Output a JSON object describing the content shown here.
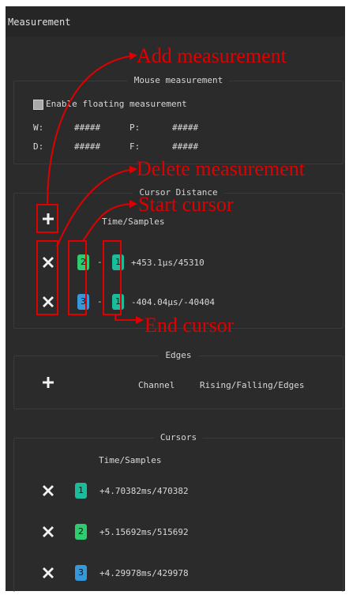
{
  "window": {
    "title": "Measurement"
  },
  "mouse_measurement": {
    "title": "Mouse measurement",
    "enable_label": "Enable floating measurement",
    "fields": [
      {
        "label": "W:",
        "value": "#####"
      },
      {
        "label": "P:",
        "value": "#####"
      },
      {
        "label": "D:",
        "value": "#####"
      },
      {
        "label": "F:",
        "value": "#####"
      }
    ]
  },
  "cursor_distance": {
    "title": "Cursor Distance",
    "header": "Time/Samples",
    "rows": [
      {
        "start": "2",
        "separator": "-",
        "end": "1",
        "value": "+453.1µs/45310"
      },
      {
        "start": "3",
        "separator": "-",
        "end": "1",
        "value": "-404.04µs/-40404"
      }
    ]
  },
  "edges": {
    "title": "Edges",
    "col_channel": "Channel",
    "col_edges": "Rising/Falling/Edges"
  },
  "cursors": {
    "title": "Cursors",
    "header": "Time/Samples",
    "rows": [
      {
        "id": "1",
        "value": "+4.70382ms/470382"
      },
      {
        "id": "2",
        "value": "+5.15692ms/515692"
      },
      {
        "id": "3",
        "value": "+4.29978ms/429978"
      }
    ]
  },
  "annotations": {
    "add": "Add measurement",
    "delete": "Delete measurement",
    "start": "Start cursor",
    "end": "End cursor"
  },
  "colors": {
    "panel_bg": "#2b2b2b",
    "badge_green": "#2ecc71",
    "badge_teal": "#1abc9c",
    "badge_blue": "#3498db",
    "annotation_red": "#e00000"
  }
}
